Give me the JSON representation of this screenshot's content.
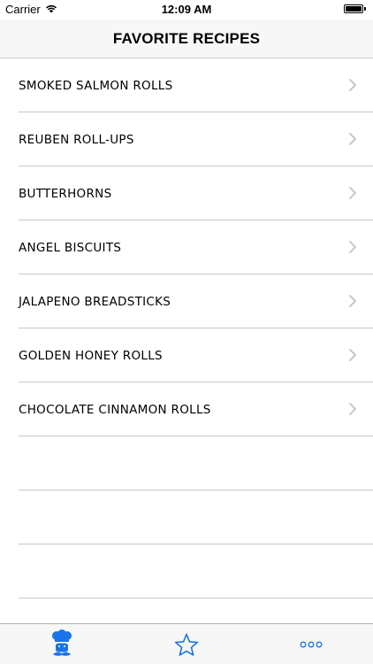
{
  "status_bar": {
    "carrier": "Carrier",
    "time": "12:09 AM",
    "battery_level": 1.0
  },
  "nav": {
    "title": "FAVORITE RECIPES"
  },
  "recipes": [
    {
      "label": "SMOKED SALMON ROLLS"
    },
    {
      "label": "REUBEN ROLL-UPS"
    },
    {
      "label": "BUTTERHORNS"
    },
    {
      "label": "ANGEL BISCUITS"
    },
    {
      "label": "JALAPENO BREADSTICKS"
    },
    {
      "label": "GOLDEN HONEY ROLLS"
    },
    {
      "label": "CHOCOLATE CINNAMON ROLLS"
    }
  ],
  "tab_bar": {
    "tabs": [
      {
        "icon": "chef-icon",
        "selected": true
      },
      {
        "icon": "star-icon",
        "selected": false
      },
      {
        "icon": "more-icon",
        "selected": false
      }
    ],
    "accent_color": "#1a73e8"
  },
  "colors": {
    "accent": "#1a73e8",
    "separator": "#c8c7cc",
    "bar_background": "#f7f7f7",
    "chevron": "#c7c7cc"
  }
}
